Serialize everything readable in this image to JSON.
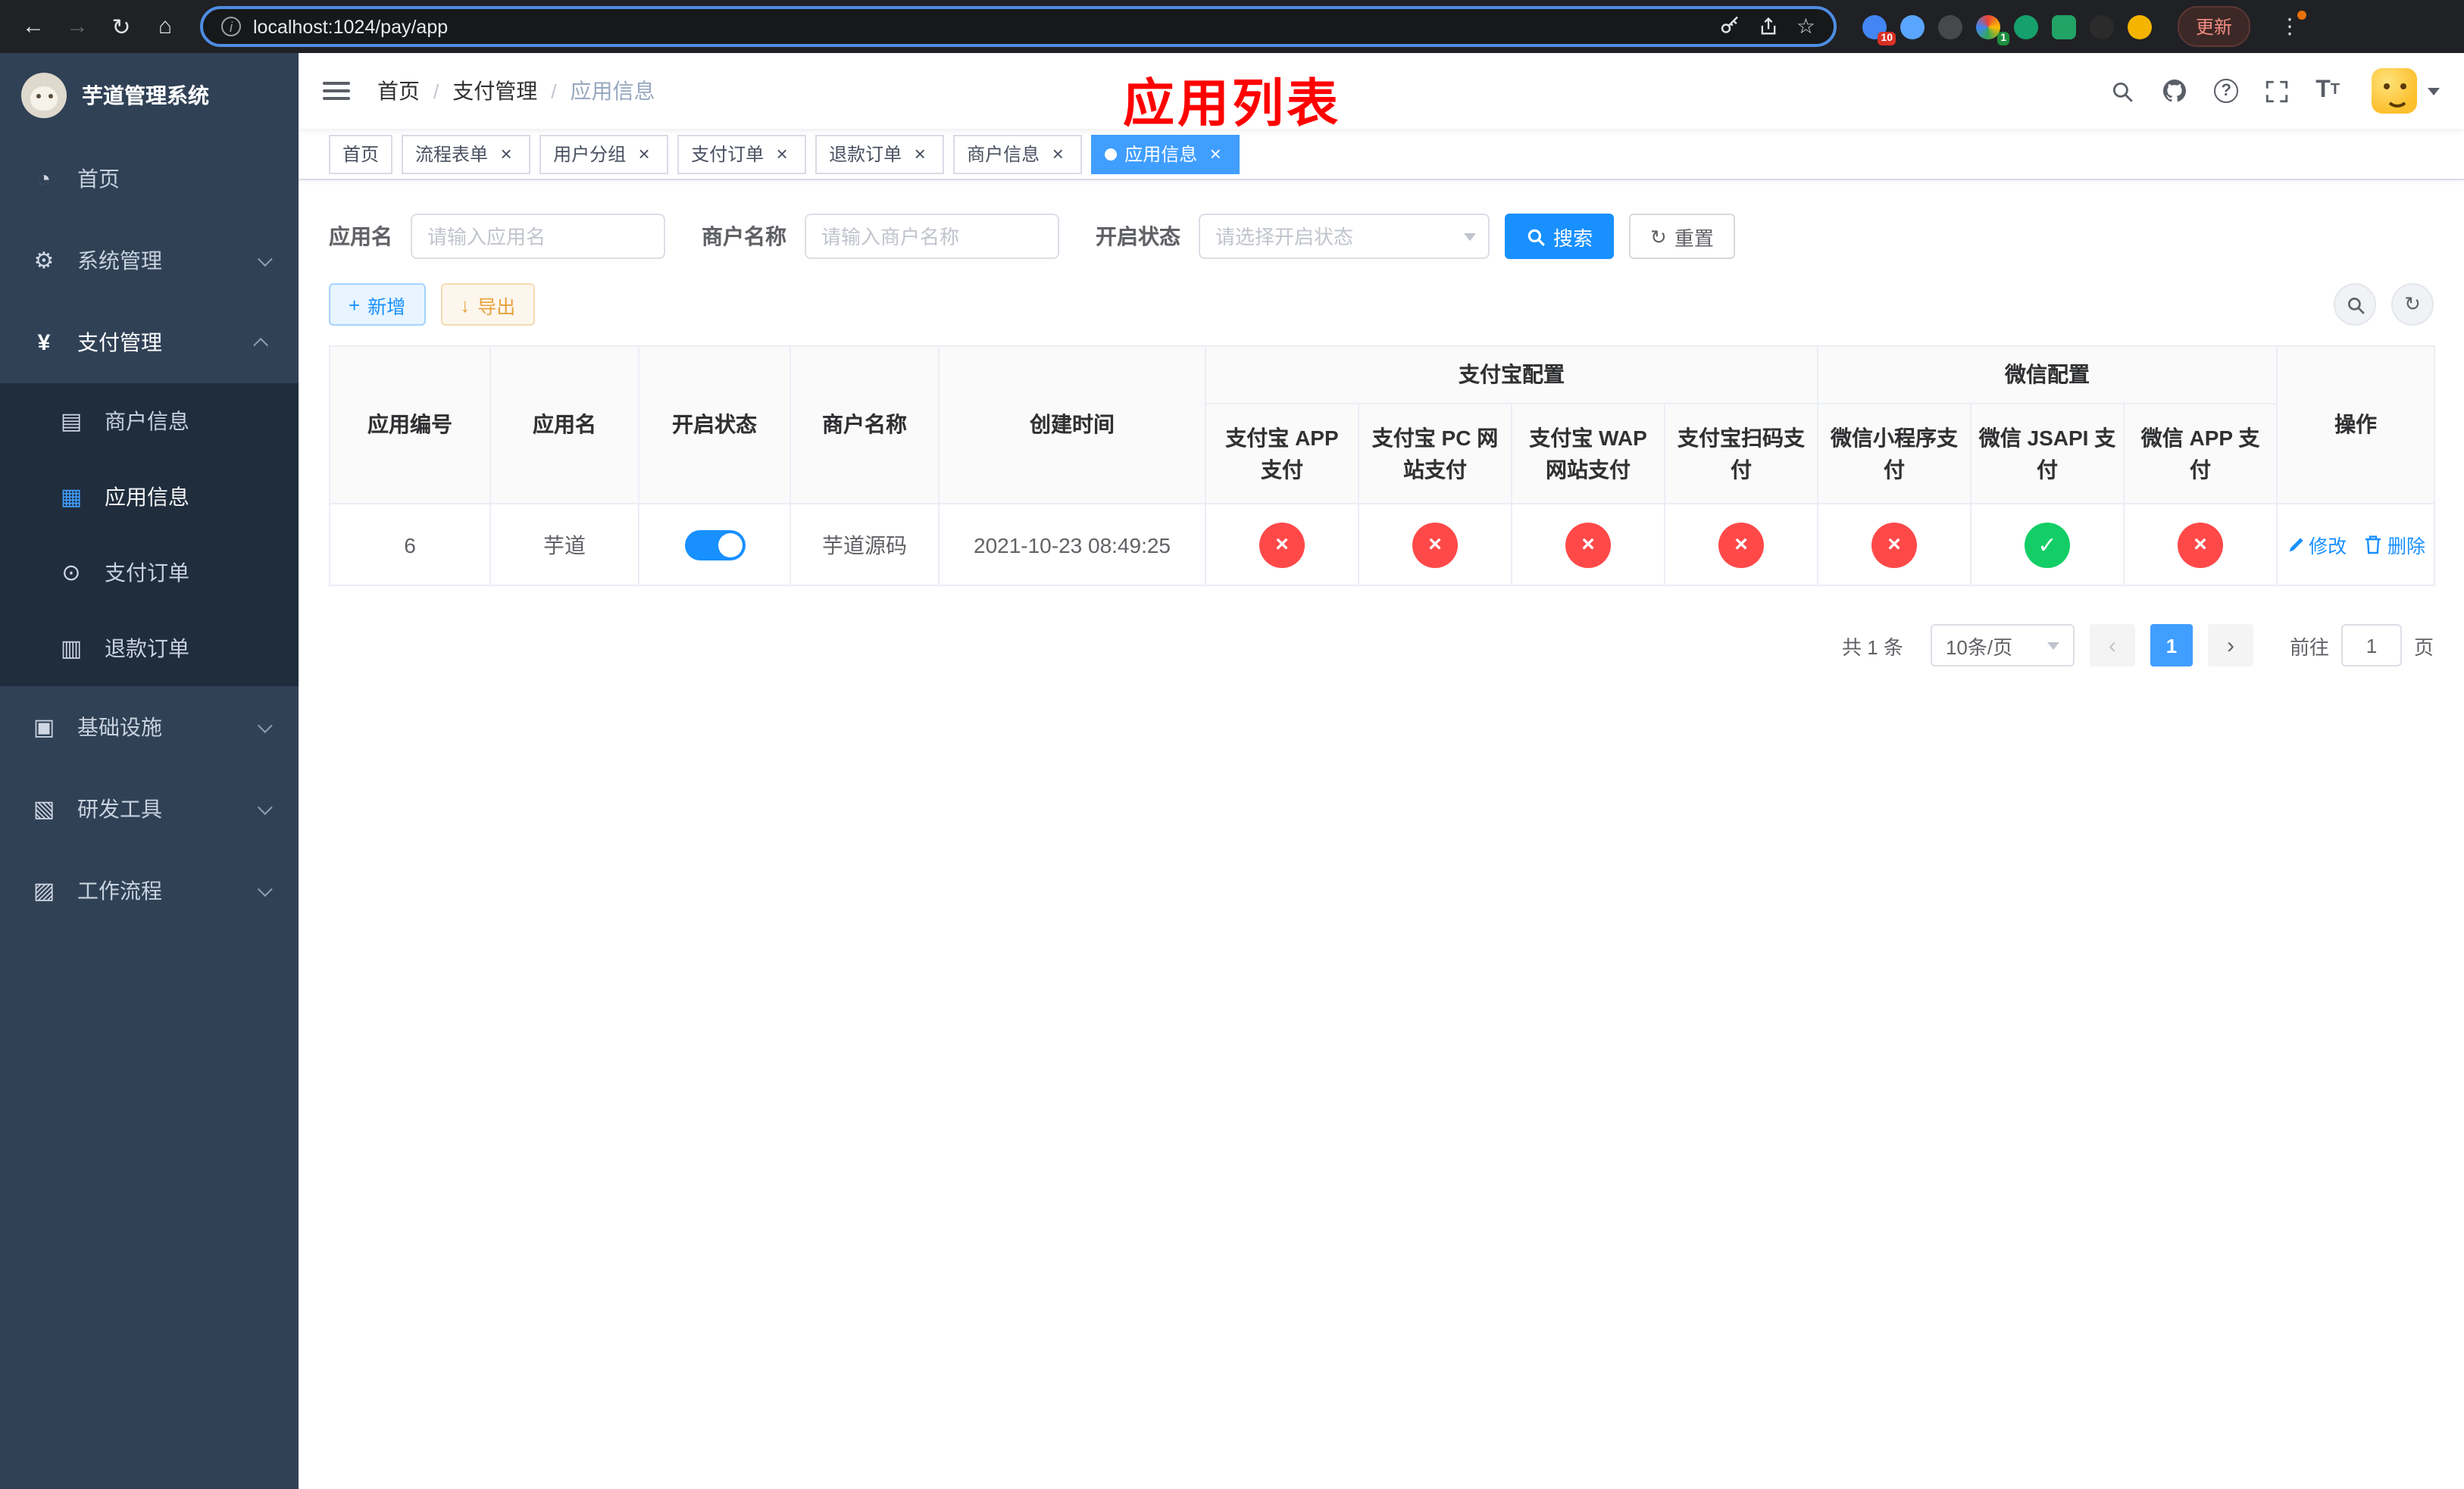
{
  "theme": {
    "primary": "#409eff",
    "button_primary": "#1890ff",
    "success": "#13ce66",
    "danger": "#ff4949",
    "warning": "#e6a23c",
    "sidebar_bg": "#304156",
    "submenu_bg": "#1f2d3d",
    "annotation_red": "#ff0000"
  },
  "icons": {
    "close": "×",
    "back": "←",
    "forward": "→",
    "reload": "↻",
    "home": "⌂",
    "star": "☆",
    "kebab": "⋮",
    "check": "✓",
    "cross": "×",
    "dashboard": "◔",
    "gear": "⚙",
    "yen": "¥",
    "merchant_card": "▤",
    "app_grid": "▦",
    "order_target": "⊙",
    "refund_doc": "▥",
    "infra_box": "▣",
    "devtools_box": "▧",
    "workflow_box": "▨",
    "plus": "+",
    "download": "↓",
    "refresh": "↻",
    "prev": "‹",
    "next": "›",
    "info": "i",
    "font_size_big": "T",
    "font_size_small": "T"
  },
  "browser": {
    "url": "localhost:1024/pay/app",
    "update_label": "更新",
    "ext_badge_blue": "10",
    "ext_badge_colorful": "1"
  },
  "overlay": {
    "title": "应用列表"
  },
  "sidebar": {
    "title": "芋道管理系统",
    "items": [
      {
        "label": "首页"
      },
      {
        "label": "系统管理"
      },
      {
        "label": "支付管理",
        "children": [
          {
            "label": "商户信息"
          },
          {
            "label": "应用信息",
            "active": true
          },
          {
            "label": "支付订单"
          },
          {
            "label": "退款订单"
          }
        ]
      },
      {
        "label": "基础设施"
      },
      {
        "label": "研发工具"
      },
      {
        "label": "工作流程"
      }
    ]
  },
  "header": {
    "breadcrumb": [
      "首页",
      "支付管理",
      "应用信息"
    ]
  },
  "tabs": [
    {
      "label": "首页",
      "closable": false,
      "active": false
    },
    {
      "label": "流程表单",
      "closable": true,
      "active": false
    },
    {
      "label": "用户分组",
      "closable": true,
      "active": false
    },
    {
      "label": "支付订单",
      "closable": true,
      "active": false
    },
    {
      "label": "退款订单",
      "closable": true,
      "active": false
    },
    {
      "label": "商户信息",
      "closable": true,
      "active": false
    },
    {
      "label": "应用信息",
      "closable": true,
      "active": true
    }
  ],
  "filters": {
    "app_name_label": "应用名",
    "app_name_placeholder": "请输入应用名",
    "merchant_label": "商户名称",
    "merchant_placeholder": "请输入商户名称",
    "status_label": "开启状态",
    "status_placeholder": "请选择开启状态",
    "search_label": "搜索",
    "reset_label": "重置"
  },
  "toolbar": {
    "add_label": "新增",
    "export_label": "导出"
  },
  "table": {
    "headers_base": [
      "应用编号",
      "应用名",
      "开启状态",
      "商户名称",
      "创建时间"
    ],
    "group_alipay": "支付宝配置",
    "group_wechat": "微信配置",
    "headers_alipay": [
      "支付宝 APP 支付",
      "支付宝 PC 网站支付",
      "支付宝 WAP 网站支付",
      "支付宝扫码支付"
    ],
    "headers_wechat": [
      "微信小程序支付",
      "微信 JSAPI 支付",
      "微信 APP 支付"
    ],
    "header_actions": "操作",
    "rows": [
      {
        "id": "6",
        "name": "芋道",
        "enabled": true,
        "merchant": "芋道源码",
        "created": "2021-10-23 08:49:25",
        "alipay": [
          false,
          false,
          false,
          false
        ],
        "wechat": [
          false,
          true,
          false
        ],
        "action_edit": "修改",
        "action_delete": "删除"
      }
    ]
  },
  "pagination": {
    "total": "共 1 条",
    "page_size": "10条/页",
    "page": "1",
    "goto_label": "前往",
    "goto_value": "1",
    "unit": "页"
  }
}
